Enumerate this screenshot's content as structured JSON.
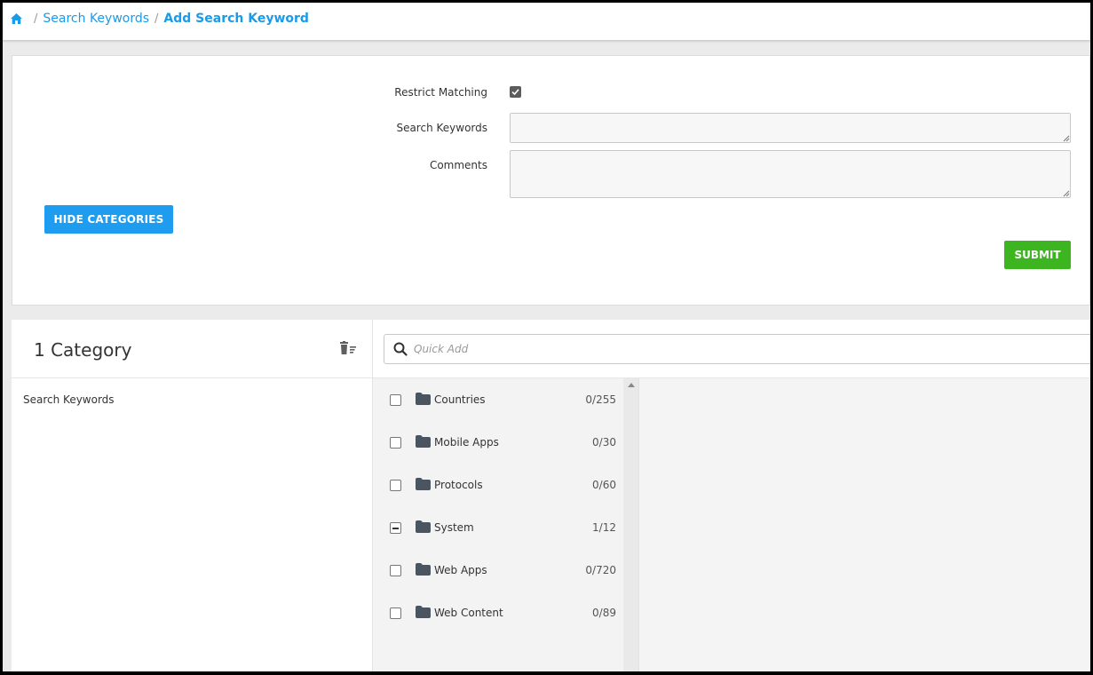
{
  "breadcrumb": {
    "home_icon": "home-icon",
    "separator": "/",
    "parent": "Search Keywords",
    "current": "Add Search Keyword"
  },
  "form": {
    "restrict_matching_label": "Restrict Matching",
    "restrict_matching_checked": true,
    "search_keywords_label": "Search Keywords",
    "search_keywords_value": "",
    "comments_label": "Comments",
    "comments_value": "",
    "hide_categories_button": "HIDE CATEGORIES",
    "submit_button": "SUBMIT"
  },
  "categories": {
    "count_label": "1 Category",
    "selected": [
      "Search Keywords"
    ],
    "quick_add_placeholder": "Quick Add",
    "tree": [
      {
        "label": "Countries",
        "count": "0/255",
        "state": "unchecked"
      },
      {
        "label": "Mobile Apps",
        "count": "0/30",
        "state": "unchecked"
      },
      {
        "label": "Protocols",
        "count": "0/60",
        "state": "unchecked"
      },
      {
        "label": "System",
        "count": "1/12",
        "state": "partial"
      },
      {
        "label": "Web Apps",
        "count": "0/720",
        "state": "unchecked"
      },
      {
        "label": "Web Content",
        "count": "0/89",
        "state": "unchecked"
      }
    ]
  },
  "colors": {
    "accent_blue": "#1e9cf0",
    "link_blue": "#1a9be8",
    "submit_green": "#3cb521",
    "folder_gray": "#4a5560"
  }
}
